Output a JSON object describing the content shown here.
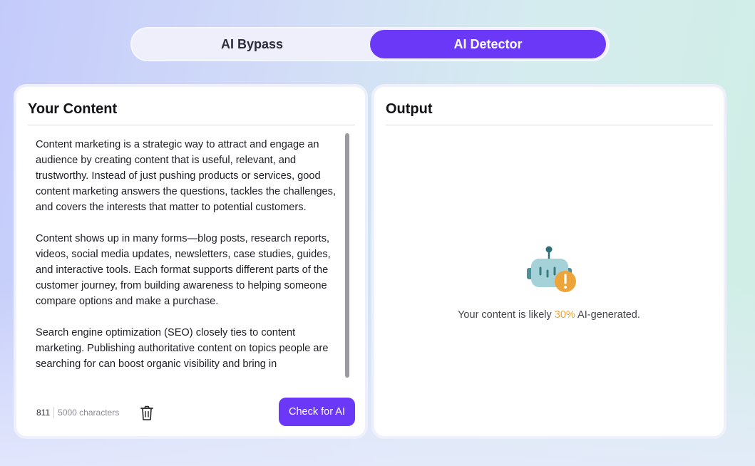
{
  "tabs": [
    {
      "label": "AI Bypass",
      "active": false
    },
    {
      "label": "AI Detector",
      "active": true
    }
  ],
  "input_panel": {
    "title": "Your Content",
    "paragraphs": [
      "Content marketing is a strategic way to attract and engage an audience by creating content that is useful, relevant, and trustworthy. Instead of just pushing products or services, good content marketing answers the questions, tackles the challenges, and covers the interests that matter to potential customers.",
      "Content shows up in many forms—blog posts, research reports, videos, social media updates, newsletters, case studies, guides, and interactive tools. Each format supports different parts of the customer journey, from building awareness to helping someone compare options and make a purchase.",
      "Search engine optimization (SEO) closely ties to content marketing. Publishing authoritative content on topics people are searching for can boost organic visibility and bring in"
    ],
    "char_count": "811",
    "char_limit": "5000 characters",
    "trash_icon": "trash-icon",
    "check_button": "Check for AI"
  },
  "output_panel": {
    "title": "Output",
    "robot_icon": "robot-warning-icon",
    "result_prefix": "Your content is likely ",
    "result_percent": "30%",
    "result_suffix": " AI-generated."
  },
  "colors": {
    "accent": "#6c38f8",
    "warning": "#eda53b",
    "robot": "#a5d2d8"
  }
}
